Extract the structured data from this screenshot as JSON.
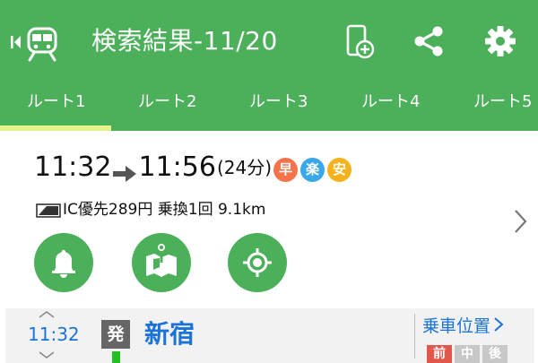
{
  "header": {
    "title": "検索結果-11/20",
    "back_icon": "train-back-icon",
    "actions": [
      {
        "name": "add-to-device",
        "icon": "phone-add-icon"
      },
      {
        "name": "share",
        "icon": "share-icon"
      },
      {
        "name": "settings",
        "icon": "gear-icon"
      }
    ],
    "colors": {
      "bar": "#4caf5a",
      "indicator": "#e6f28a"
    }
  },
  "tabs": [
    {
      "label": "ルート1",
      "selected": true
    },
    {
      "label": "ルート2",
      "selected": false
    },
    {
      "label": "ルート3",
      "selected": false
    },
    {
      "label": "ルート4",
      "selected": false
    },
    {
      "label": "ルート5",
      "selected": false
    }
  ],
  "route": {
    "depart_time": "11:32",
    "arrive_time": "11:56",
    "duration": "(24分)",
    "badges": [
      {
        "label": "早",
        "color": "#f4734a"
      },
      {
        "label": "楽",
        "color": "#39a7e8"
      },
      {
        "label": "安",
        "color": "#f5b21c"
      }
    ],
    "fare": "IC優先289円",
    "transfers": "乗換1回",
    "distance": "9.1km"
  },
  "actions": [
    {
      "name": "alarm",
      "icon": "bell-icon"
    },
    {
      "name": "map",
      "icon": "map-pin-icon"
    },
    {
      "name": "locate",
      "icon": "crosshair-icon"
    }
  ],
  "station": {
    "time": "11:32",
    "dep_badge": "発",
    "name": "新宿",
    "position_label": "乗車位置",
    "cars": [
      {
        "label": "前",
        "color": "#e2574c"
      },
      {
        "label": "中",
        "color": "#c8c8c8"
      },
      {
        "label": "後",
        "color": "#c8c8c8"
      }
    ],
    "line_color": "#22c021"
  }
}
